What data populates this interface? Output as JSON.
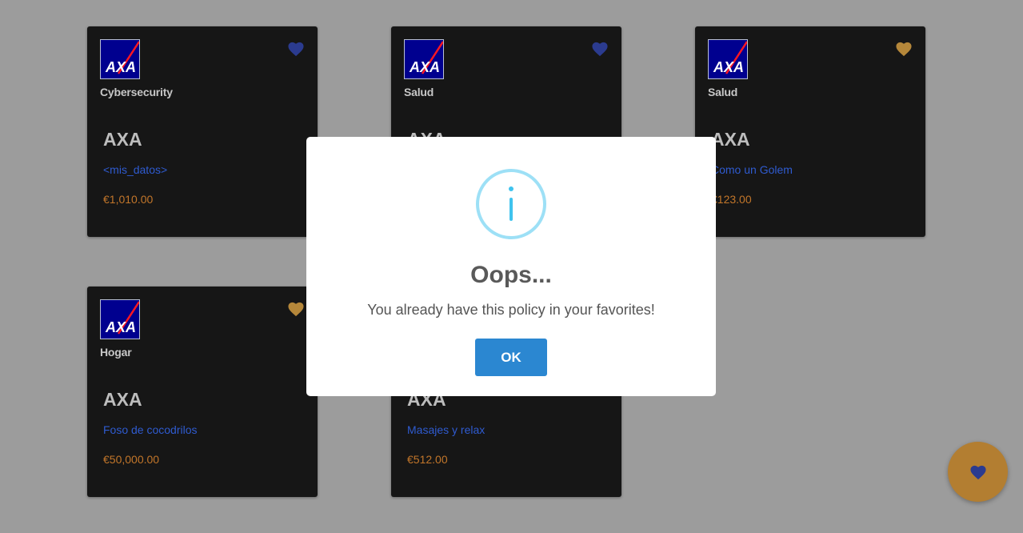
{
  "colors": {
    "heart_blue": "#2b3b8f",
    "heart_gold": "#b5873a",
    "policy_link": "#2f5bd0",
    "price": "#c2762a",
    "info_accent": "#3fc3ee",
    "ok_button": "#2b87d1",
    "fab": "#b37e31"
  },
  "cards": [
    {
      "category": "Cybersecurity",
      "company": "AXA",
      "policy": "<mis_datos>",
      "price": "€1,010.00",
      "favorite": false
    },
    {
      "category": "Salud",
      "company": "AXA",
      "policy": "",
      "price": "",
      "favorite": false
    },
    {
      "category": "Salud",
      "company": "AXA",
      "policy": "Como un Golem",
      "price": "€123.00",
      "favorite": true
    },
    {
      "category": "Hogar",
      "company": "AXA",
      "policy": "Foso de cocodrilos",
      "price": "€50,000.00",
      "favorite": true
    },
    {
      "category": "",
      "company": "AXA",
      "policy": "Masajes y relax",
      "price": "€512.00",
      "favorite": false
    }
  ],
  "logo_text": "AXA",
  "modal": {
    "icon": "info-icon",
    "title": "Oops...",
    "message": "You already have this policy in your favorites!",
    "ok_label": "OK"
  },
  "fab": {
    "icon": "heart-icon"
  }
}
